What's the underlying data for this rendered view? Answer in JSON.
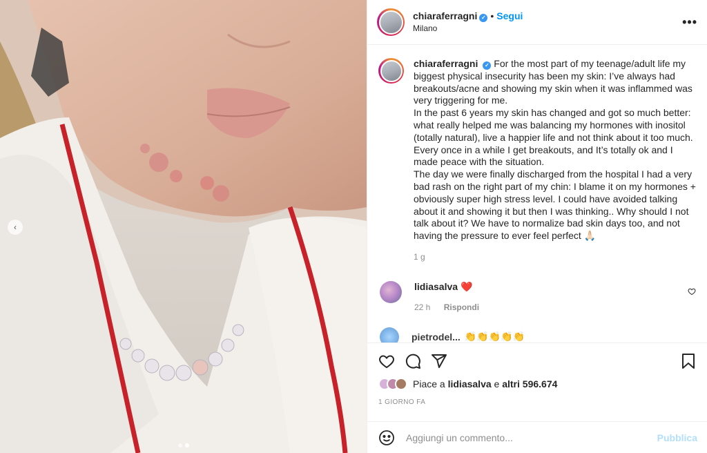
{
  "post": {
    "username": "chiaraferragni",
    "follow_label": "Segui",
    "location": "Milano",
    "separator": "•",
    "more_label": "•••"
  },
  "caption": {
    "username": "chiaraferragni",
    "paragraphs": [
      "For the most part of my teenage/adult life my biggest physical insecurity has been my skin: I’ve always had breakouts/acne and showing my skin when it was inflammed was very triggering for me.",
      "In the past 6 years my skin has changed and got so much better: what really helped me was balancing my hormones with inositol (totally natural), live a happier life and not think about it too much. Every once in a while I get breakouts, and It’s totally ok and I made peace with the situation.",
      "The day we were finally discharged from the hospital I had a very bad rash on the right part of my chin: I blame it on my hormones + obviously super high stress level. I could have avoided talking about it and showing it but then I was thinking.. Why should I not talk about it? We have to normalize bad skin days too, and not having the pressure to ever feel perfect 🙏🏻"
    ],
    "time": "1 g"
  },
  "comments": [
    {
      "username": "lidiasalva",
      "text": "❤️",
      "time": "22 h",
      "reply_label": "Rispondi"
    }
  ],
  "next_comment": {
    "username": "pietrodel...",
    "text": "👏👏👏👏👏"
  },
  "likes": {
    "prefix": "Piace a ",
    "user": "lidiasalva",
    "middle": " e ",
    "others": "altri 596.674"
  },
  "date": "1 GIORNO FA",
  "add_comment": {
    "placeholder": "Aggiungi un commento...",
    "publish_label": "Pubblica"
  },
  "carousel": {
    "prev_icon": "chevron-left-icon",
    "slides": 2,
    "active": 1
  },
  "colors": {
    "accent": "#0095f6",
    "publish_disabled": "#b2dffc",
    "muted": "#8e8e8e"
  }
}
